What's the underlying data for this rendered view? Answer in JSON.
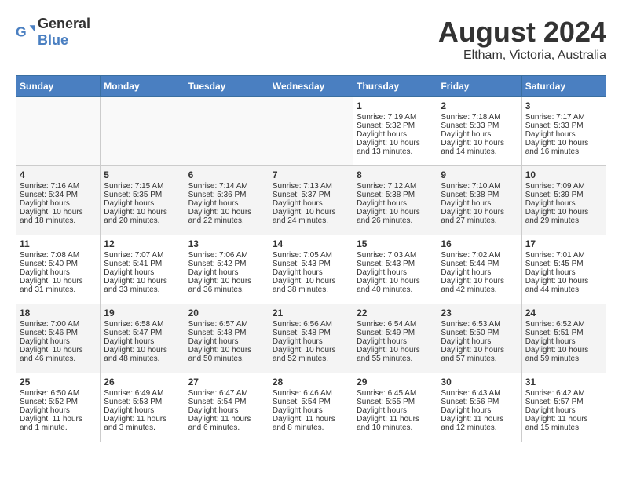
{
  "header": {
    "logo_general": "General",
    "logo_blue": "Blue",
    "month_year": "August 2024",
    "location": "Eltham, Victoria, Australia"
  },
  "days_of_week": [
    "Sunday",
    "Monday",
    "Tuesday",
    "Wednesday",
    "Thursday",
    "Friday",
    "Saturday"
  ],
  "weeks": [
    {
      "days": [
        {
          "num": "",
          "empty": true
        },
        {
          "num": "",
          "empty": true
        },
        {
          "num": "",
          "empty": true
        },
        {
          "num": "",
          "empty": true
        },
        {
          "num": "1",
          "sunrise": "7:19 AM",
          "sunset": "5:32 PM",
          "daylight": "10 hours and 13 minutes."
        },
        {
          "num": "2",
          "sunrise": "7:18 AM",
          "sunset": "5:33 PM",
          "daylight": "10 hours and 14 minutes."
        },
        {
          "num": "3",
          "sunrise": "7:17 AM",
          "sunset": "5:33 PM",
          "daylight": "10 hours and 16 minutes."
        }
      ]
    },
    {
      "days": [
        {
          "num": "4",
          "sunrise": "7:16 AM",
          "sunset": "5:34 PM",
          "daylight": "10 hours and 18 minutes."
        },
        {
          "num": "5",
          "sunrise": "7:15 AM",
          "sunset": "5:35 PM",
          "daylight": "10 hours and 20 minutes."
        },
        {
          "num": "6",
          "sunrise": "7:14 AM",
          "sunset": "5:36 PM",
          "daylight": "10 hours and 22 minutes."
        },
        {
          "num": "7",
          "sunrise": "7:13 AM",
          "sunset": "5:37 PM",
          "daylight": "10 hours and 24 minutes."
        },
        {
          "num": "8",
          "sunrise": "7:12 AM",
          "sunset": "5:38 PM",
          "daylight": "10 hours and 26 minutes."
        },
        {
          "num": "9",
          "sunrise": "7:10 AM",
          "sunset": "5:38 PM",
          "daylight": "10 hours and 27 minutes."
        },
        {
          "num": "10",
          "sunrise": "7:09 AM",
          "sunset": "5:39 PM",
          "daylight": "10 hours and 29 minutes."
        }
      ]
    },
    {
      "days": [
        {
          "num": "11",
          "sunrise": "7:08 AM",
          "sunset": "5:40 PM",
          "daylight": "10 hours and 31 minutes."
        },
        {
          "num": "12",
          "sunrise": "7:07 AM",
          "sunset": "5:41 PM",
          "daylight": "10 hours and 33 minutes."
        },
        {
          "num": "13",
          "sunrise": "7:06 AM",
          "sunset": "5:42 PM",
          "daylight": "10 hours and 36 minutes."
        },
        {
          "num": "14",
          "sunrise": "7:05 AM",
          "sunset": "5:43 PM",
          "daylight": "10 hours and 38 minutes."
        },
        {
          "num": "15",
          "sunrise": "7:03 AM",
          "sunset": "5:43 PM",
          "daylight": "10 hours and 40 minutes."
        },
        {
          "num": "16",
          "sunrise": "7:02 AM",
          "sunset": "5:44 PM",
          "daylight": "10 hours and 42 minutes."
        },
        {
          "num": "17",
          "sunrise": "7:01 AM",
          "sunset": "5:45 PM",
          "daylight": "10 hours and 44 minutes."
        }
      ]
    },
    {
      "days": [
        {
          "num": "18",
          "sunrise": "7:00 AM",
          "sunset": "5:46 PM",
          "daylight": "10 hours and 46 minutes."
        },
        {
          "num": "19",
          "sunrise": "6:58 AM",
          "sunset": "5:47 PM",
          "daylight": "10 hours and 48 minutes."
        },
        {
          "num": "20",
          "sunrise": "6:57 AM",
          "sunset": "5:48 PM",
          "daylight": "10 hours and 50 minutes."
        },
        {
          "num": "21",
          "sunrise": "6:56 AM",
          "sunset": "5:48 PM",
          "daylight": "10 hours and 52 minutes."
        },
        {
          "num": "22",
          "sunrise": "6:54 AM",
          "sunset": "5:49 PM",
          "daylight": "10 hours and 55 minutes."
        },
        {
          "num": "23",
          "sunrise": "6:53 AM",
          "sunset": "5:50 PM",
          "daylight": "10 hours and 57 minutes."
        },
        {
          "num": "24",
          "sunrise": "6:52 AM",
          "sunset": "5:51 PM",
          "daylight": "10 hours and 59 minutes."
        }
      ]
    },
    {
      "days": [
        {
          "num": "25",
          "sunrise": "6:50 AM",
          "sunset": "5:52 PM",
          "daylight": "11 hours and 1 minute."
        },
        {
          "num": "26",
          "sunrise": "6:49 AM",
          "sunset": "5:53 PM",
          "daylight": "11 hours and 3 minutes."
        },
        {
          "num": "27",
          "sunrise": "6:47 AM",
          "sunset": "5:54 PM",
          "daylight": "11 hours and 6 minutes."
        },
        {
          "num": "28",
          "sunrise": "6:46 AM",
          "sunset": "5:54 PM",
          "daylight": "11 hours and 8 minutes."
        },
        {
          "num": "29",
          "sunrise": "6:45 AM",
          "sunset": "5:55 PM",
          "daylight": "11 hours and 10 minutes."
        },
        {
          "num": "30",
          "sunrise": "6:43 AM",
          "sunset": "5:56 PM",
          "daylight": "11 hours and 12 minutes."
        },
        {
          "num": "31",
          "sunrise": "6:42 AM",
          "sunset": "5:57 PM",
          "daylight": "11 hours and 15 minutes."
        }
      ]
    }
  ]
}
